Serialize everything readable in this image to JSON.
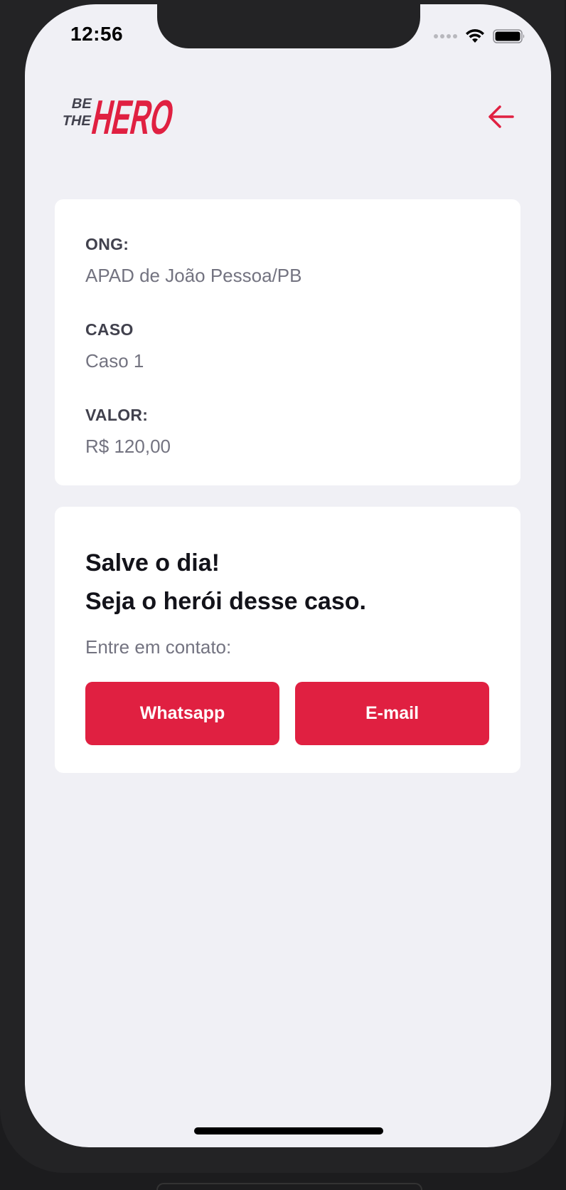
{
  "status_bar": {
    "time": "12:56"
  },
  "header": {
    "logo_text_small_top": "BE",
    "logo_text_small_bottom": "THE",
    "logo_text_big": "HERO",
    "back_icon": "arrow-left-icon"
  },
  "incident": {
    "ong_label": "ONG:",
    "ong_value": "APAD de João Pessoa/PB",
    "case_label": "CASO",
    "case_value": "Caso 1",
    "value_label": "VALOR:",
    "value_value": "R$ 120,00"
  },
  "contact": {
    "title_line1": "Salve o dia!",
    "title_line2": "Seja o herói desse caso.",
    "description": "Entre em contato:",
    "whatsapp_label": "Whatsapp",
    "email_label": "E-mail"
  },
  "colors": {
    "brand": "#e02041",
    "background": "#f0f0f5",
    "card": "#ffffff"
  }
}
